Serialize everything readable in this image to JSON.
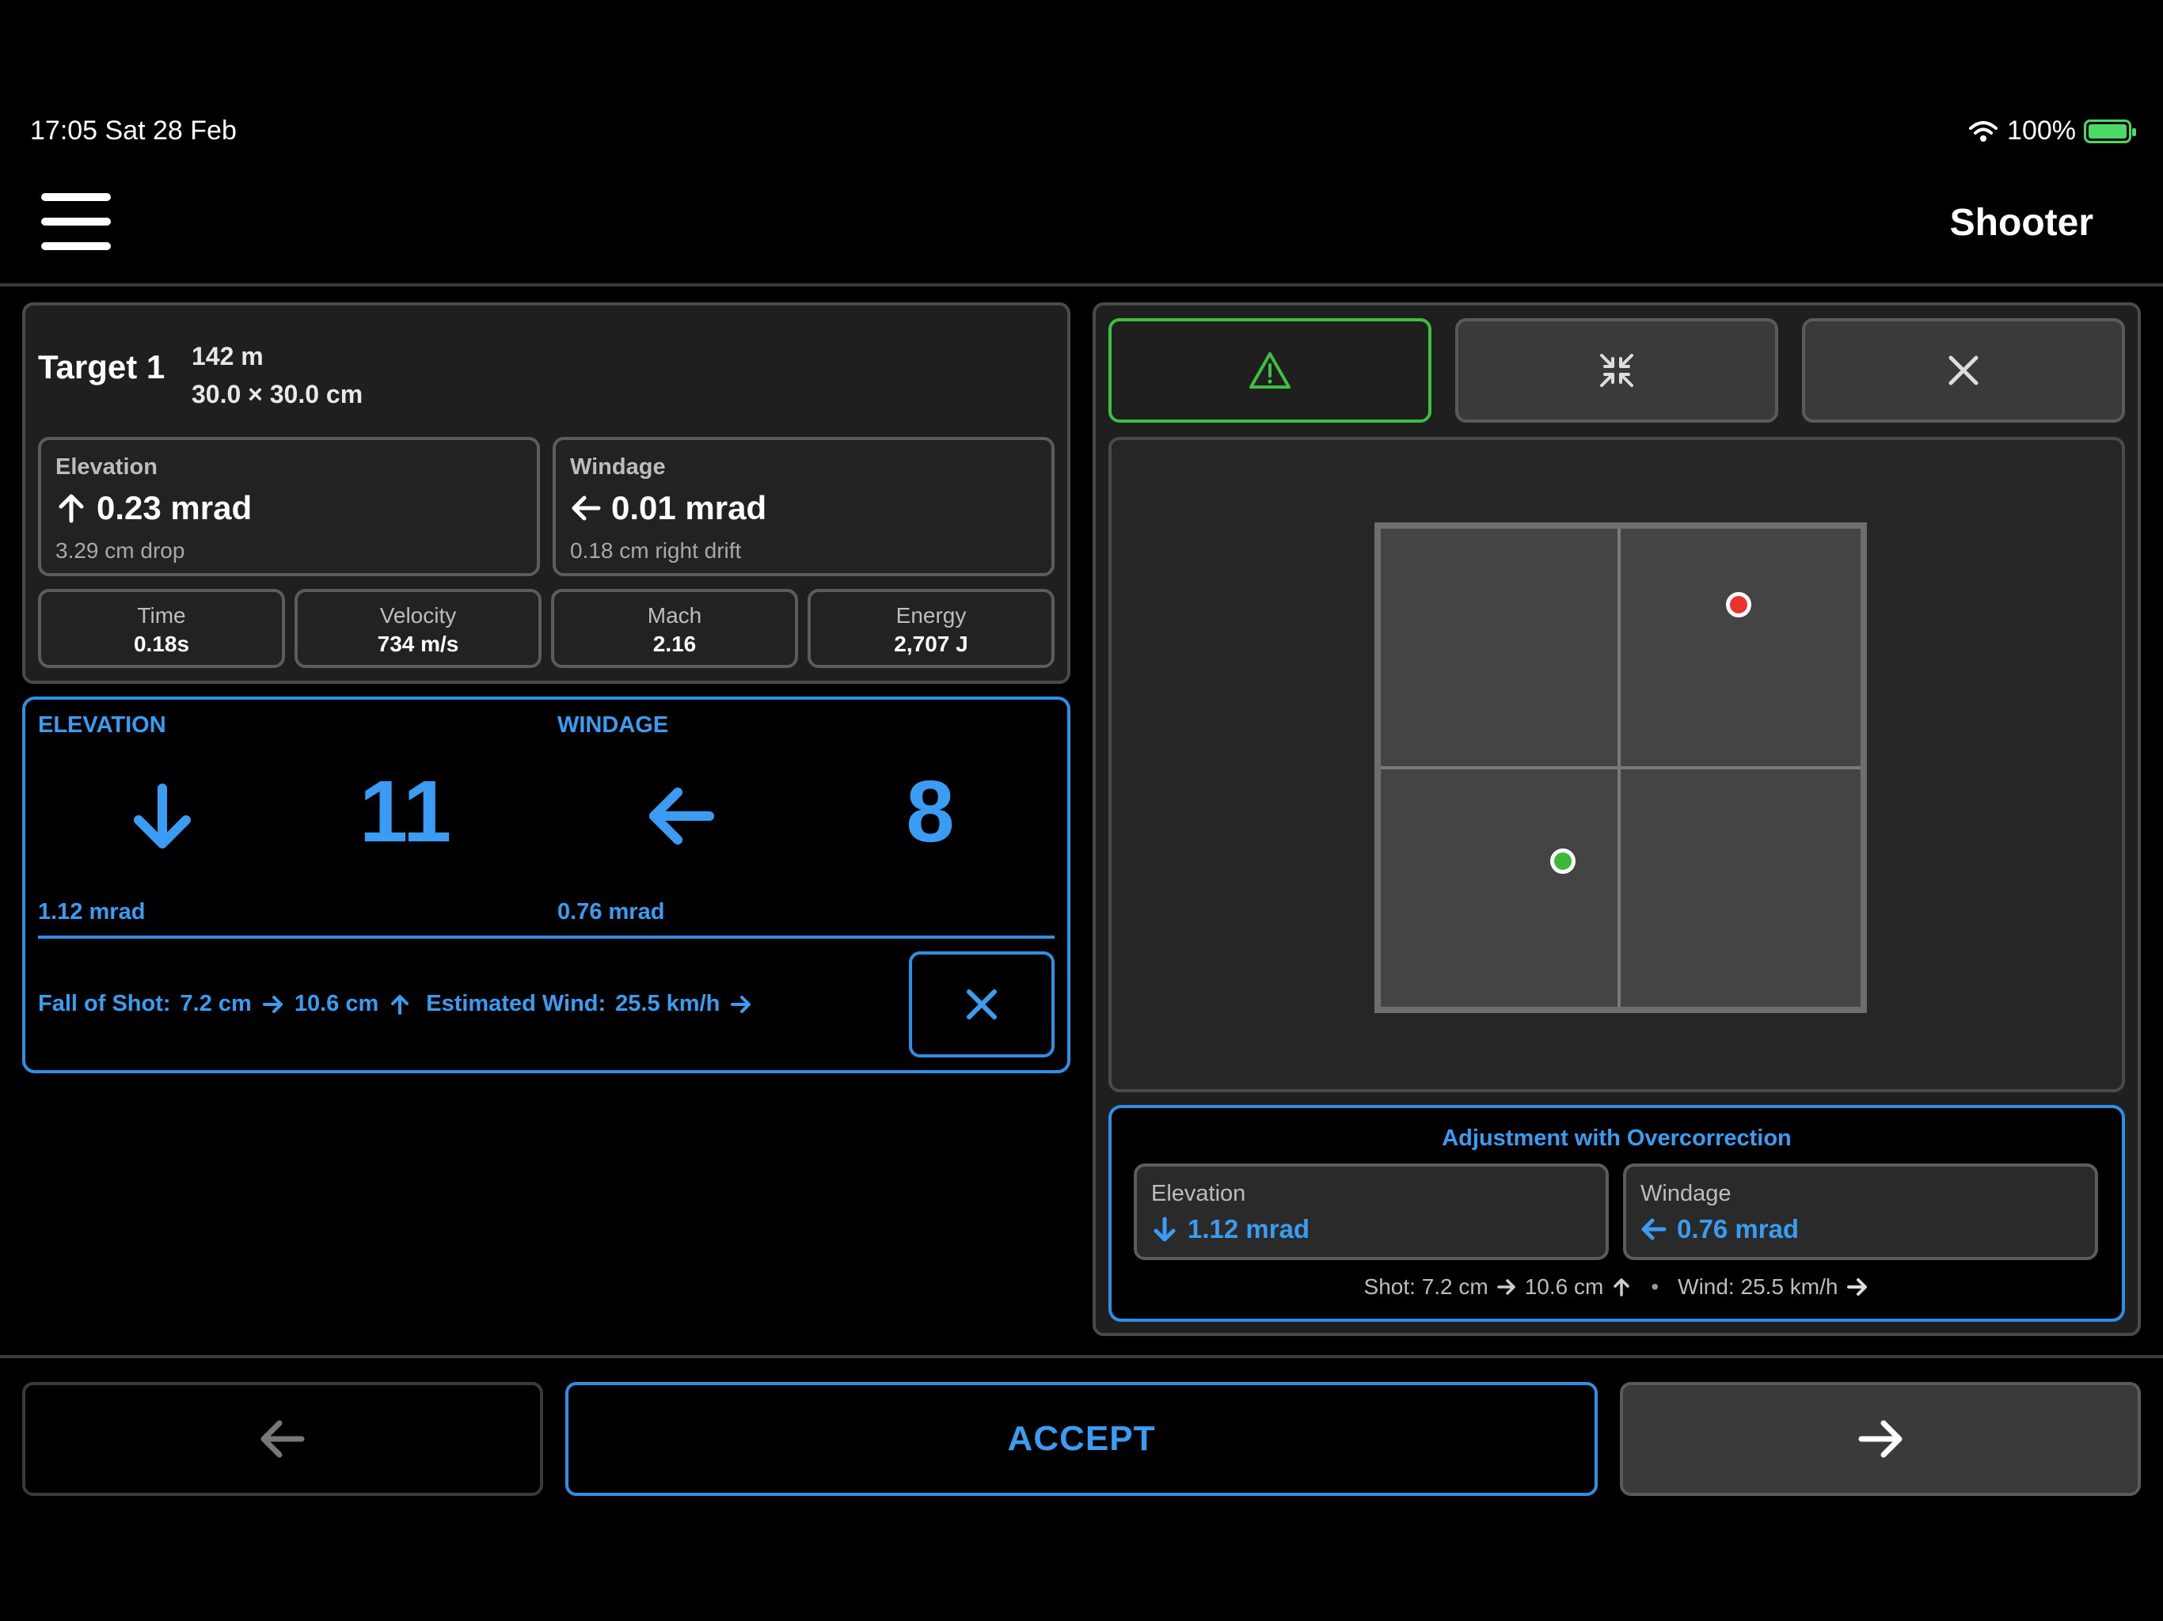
{
  "status_bar": {
    "time_date": "17:05   Sat 28 Feb",
    "battery_percent": "100%"
  },
  "nav": {
    "title": "Shooter",
    "menu_icon": "hamburger-menu-icon"
  },
  "target": {
    "name": "Target 1",
    "distance": "142 m",
    "size": "30.0 × 30.0 cm"
  },
  "solution": {
    "elevation": {
      "label": "Elevation",
      "value": "0.23 mrad",
      "sub": "3.29 cm drop",
      "icon": "arrow-up-icon"
    },
    "windage": {
      "label": "Windage",
      "value": "0.01 mrad",
      "sub": "0.18 cm right drift",
      "icon": "arrow-left-icon"
    }
  },
  "stats": [
    {
      "label": "Time",
      "value": "0.18s"
    },
    {
      "label": "Velocity",
      "value": "734 m/s"
    },
    {
      "label": "Mach",
      "value": "2.16"
    },
    {
      "label": "Energy",
      "value": "2,707 J"
    }
  ],
  "correction": {
    "elevation_label": "ELEVATION",
    "elevation_clicks": "11",
    "elevation_mrad": "1.12 mrad",
    "windage_label": "WINDAGE",
    "windage_clicks": "8",
    "windage_mrad": "0.76 mrad",
    "fall_label": "Fall of Shot:",
    "fall_x": "7.2 cm",
    "fall_y": "10.6 cm",
    "wind_label": "Estimated Wind:",
    "wind_value": "25.5 km/h"
  },
  "adjustment": {
    "title": "Adjustment with Overcorrection",
    "elevation_label": "Elevation",
    "elevation_value": "1.12 mrad",
    "windage_label": "Windage",
    "windage_value": "0.76 mrad",
    "shot_text": "Shot: 7.2 cm",
    "shot_y": "10.6 cm",
    "wind_text": "Wind: 25.5 km/h"
  },
  "footer": {
    "accept_label": "ACCEPT"
  },
  "colors": {
    "accent_blue": "#3a9cf2",
    "warning_green": "#3fbf3f",
    "impact_red": "#e8322b",
    "aim_green": "#3db83d"
  }
}
